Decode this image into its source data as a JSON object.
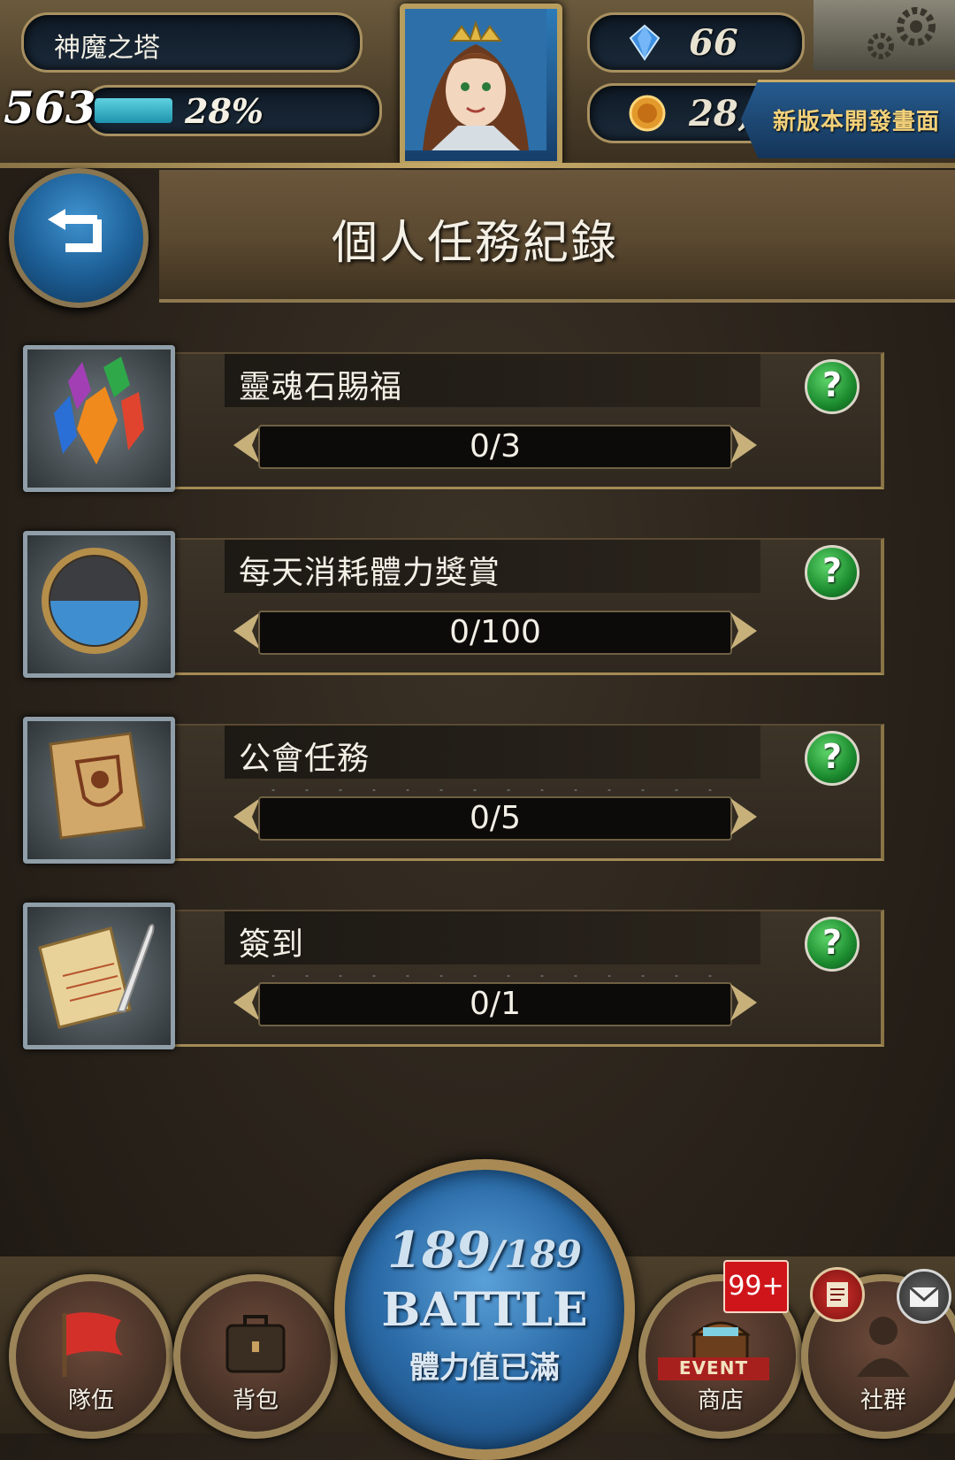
{
  "header": {
    "game_name": "神魔之塔",
    "level": "563",
    "exp_percent_text": "28%",
    "exp_progress": 0.28,
    "diamonds": "66",
    "coins": "28,",
    "new_version_label": "新版本開發畫面"
  },
  "page": {
    "title": "個人任務紀錄"
  },
  "quests": [
    {
      "name": "靈魂石賜福",
      "progress": "0/3",
      "icon": "soul-stones-icon"
    },
    {
      "name": "每天消耗體力獎賞",
      "progress": "0/100",
      "icon": "stamina-orb-icon"
    },
    {
      "name": "公會任務",
      "progress": "0/5",
      "icon": "guild-scroll-icon"
    },
    {
      "name": "簽到",
      "progress": "0/1",
      "icon": "check-in-record-icon"
    }
  ],
  "help_label": "?",
  "bottom_nav": {
    "team_label": "隊伍",
    "bag_label": "背包",
    "shop_label": "商店",
    "shop_event_tag": "EVENT",
    "shop_badge": "99+",
    "social_label": "社群"
  },
  "battle": {
    "stamina": "189",
    "stamina_max": "/189",
    "label": "BATTLE",
    "status": "體力值已滿"
  },
  "colors": {
    "accent_gold": "#b79d5e",
    "exp_bar": "#1d93ad",
    "help_green": "#1b8a2e",
    "battle_blue": "#2a6aa6",
    "badge_red": "#d0151a"
  }
}
